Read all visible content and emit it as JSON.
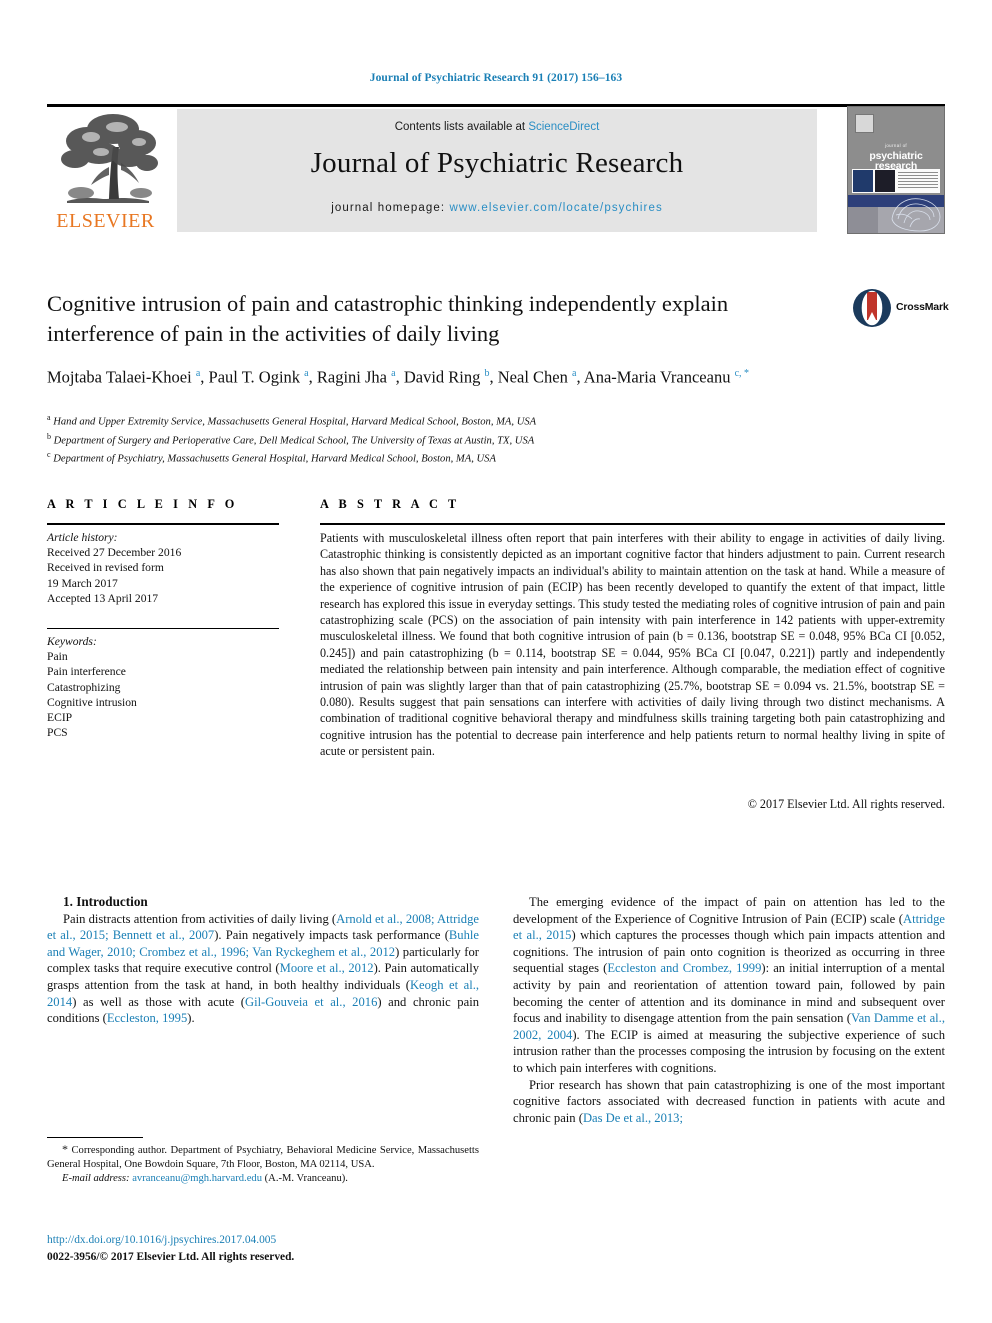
{
  "running_head": "Journal of Psychiatric Research 91 (2017) 156–163",
  "masthead": {
    "contents_prefix": "Contents lists available at ",
    "contents_link": "ScienceDirect",
    "journal_name": "Journal of Psychiatric Research",
    "homepage_prefix": "journal homepage: ",
    "homepage_url": "www.elsevier.com/locate/psychires",
    "publisher": "ELSEVIER",
    "cover_title_sup": "journal of",
    "cover_title_line1": "psychiatric",
    "cover_title_line2": "research",
    "link_color": "#2a8ec4",
    "band_color": "#e4e4e4"
  },
  "article": {
    "title": "Cognitive intrusion of pain and catastrophic thinking independently explain interference of pain in the activities of daily living",
    "crossmark_label": "CrossMark",
    "authors_html": "Mojtaba Talaei-Khoei <sup>a</sup>, Paul T. Ogink <sup>a</sup>, Ragini Jha <sup>a</sup>, David Ring <sup>b</sup>, Neal Chen <sup>a</sup>, Ana-Maria Vranceanu <sup>c, *</sup>",
    "affiliations": [
      {
        "marker": "a",
        "text": "Hand and Upper Extremity Service, Massachusetts General Hospital, Harvard Medical School, Boston, MA, USA"
      },
      {
        "marker": "b",
        "text": "Department of Surgery and Perioperative Care, Dell Medical School, The University of Texas at Austin, TX, USA"
      },
      {
        "marker": "c",
        "text": "Department of Psychiatry, Massachusetts General Hospital, Harvard Medical School, Boston, MA, USA"
      }
    ]
  },
  "article_info": {
    "heading": "A R T I C L E  I N F O",
    "history_label": "Article history:",
    "history": [
      "Received 27 December 2016",
      "Received in revised form",
      "19 March 2017",
      "Accepted 13 April 2017"
    ],
    "keywords_label": "Keywords:",
    "keywords": [
      "Pain",
      "Pain interference",
      "Catastrophizing",
      "Cognitive intrusion",
      "ECIP",
      "PCS"
    ]
  },
  "abstract": {
    "heading": "A B S T R A C T",
    "text": "Patients with musculoskeletal illness often report that pain interferes with their ability to engage in activities of daily living. Catastrophic thinking is consistently depicted as an important cognitive factor that hinders adjustment to pain. Current research has also shown that pain negatively impacts an individual's ability to maintain attention on the task at hand. While a measure of the experience of cognitive intrusion of pain (ECIP) has been recently developed to quantify the extent of that impact, little research has explored this issue in everyday settings. This study tested the mediating roles of cognitive intrusion of pain and pain catastrophizing scale (PCS) on the association of pain intensity with pain interference in 142 patients with upper-extremity musculoskeletal illness. We found that both cognitive intrusion of pain (b = 0.136, bootstrap SE = 0.048, 95% BCa CI [0.052, 0.245]) and pain catastrophizing (b = 0.114, bootstrap SE = 0.044, 95% BCa CI [0.047, 0.221]) partly and independently mediated the relationship between pain intensity and pain interference. Although comparable, the mediation effect of cognitive intrusion of pain was slightly larger than that of pain catastrophizing (25.7%, bootstrap SE = 0.094 vs. 21.5%, bootstrap SE = 0.080). Results suggest that pain sensations can interfere with activities of daily living through two distinct mechanisms. A combination of traditional cognitive behavioral therapy and mindfulness skills training targeting both pain catastrophizing and cognitive intrusion has the potential to decrease pain interference and help patients return to normal healthy living in spite of acute or persistent pain.",
    "copyright": "© 2017 Elsevier Ltd. All rights reserved."
  },
  "body": {
    "section_heading": "1. Introduction",
    "left_paragraphs": [
      "Pain distracts attention from activities of daily living (<span class=\"ref\">Arnold et al., 2008; Attridge et al., 2015; Bennett et al., 2007</span>). Pain negatively impacts task performance (<span class=\"ref\">Buhle and Wager, 2010; Crombez et al., 1996; Van Ryckeghem et al., 2012</span>) particularly for complex tasks that require executive control (<span class=\"ref\">Moore et al., 2012</span>). Pain automatically grasps attention from the task at hand, in both healthy individuals (<span class=\"ref\">Keogh et al., 2014</span>) as well as those with acute (<span class=\"ref\">Gil-Gouveia et al., 2016</span>) and chronic pain conditions (<span class=\"ref\">Eccleston, 1995</span>)."
    ],
    "right_paragraphs": [
      "The emerging evidence of the impact of pain on attention has led to the development of the Experience of Cognitive Intrusion of Pain (ECIP) scale (<span class=\"ref\">Attridge et al., 2015</span>) which captures the processes though which pain impacts attention and cognitions. The intrusion of pain onto cognition is theorized as occurring in three sequential stages (<span class=\"ref\">Eccleston and Crombez, 1999</span>): an initial interruption of a mental activity by pain and reorientation of attention toward pain, followed by pain becoming the center of attention and its dominance in mind and subsequent over focus and inability to disengage attention from the pain sensation (<span class=\"ref\">Van Damme et al., 2002, 2004</span>). The ECIP is aimed at measuring the subjective experience of such intrusion rather than the processes composing the intrusion by focusing on the extent to which pain interferes with cognitions.",
      "Prior research has shown that pain catastrophizing is one of the most important cognitive factors associated with decreased function in patients with acute and chronic pain (<span class=\"ref\">Das De et al., 2013;</span>"
    ]
  },
  "footer": {
    "corresponding_html": "<span style=\"font-size:12px\">*</span> Corresponding author. Department of Psychiatry, Behavioral Medicine Service, Massachusetts General Hospital, One Bowdoin Square, 7th Floor, Boston, MA 02114, USA.",
    "email_label": "E-mail address:",
    "email": "avranceanu@mgh.harvard.edu",
    "email_suffix": "(A.-M. Vranceanu).",
    "doi": "http://dx.doi.org/10.1016/j.jpsychires.2017.04.005",
    "issn_line": "0022-3956/© 2017 Elsevier Ltd. All rights reserved."
  }
}
